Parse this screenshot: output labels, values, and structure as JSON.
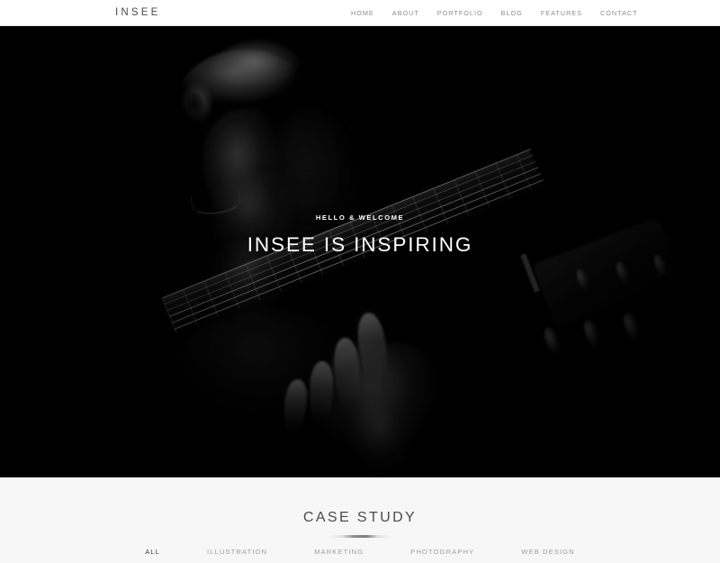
{
  "header": {
    "logo": "INSEE",
    "nav": [
      {
        "label": "HOME"
      },
      {
        "label": "ABOUT"
      },
      {
        "label": "PORTFOLIO"
      },
      {
        "label": "BLOG"
      },
      {
        "label": "FEATURES"
      },
      {
        "label": "CONTACT"
      }
    ]
  },
  "hero": {
    "subtitle": "HELLO & WELCOME",
    "title": "INSEE IS INSPIRING",
    "background_description": "dark monochrome photo of a man's face in profile with a hand fretting an acoustic guitar neck",
    "background_color": "#000000"
  },
  "case_study": {
    "title": "CASE STUDY",
    "filters": [
      {
        "label": "ALL",
        "active": true
      },
      {
        "label": "ILLUSTRATION",
        "active": false
      },
      {
        "label": "MARKETING",
        "active": false
      },
      {
        "label": "PHOTOGRAPHY",
        "active": false
      },
      {
        "label": "WEB DESIGN",
        "active": false
      }
    ],
    "background_color": "#f7f7f7"
  },
  "colors": {
    "page_background": "#ffffff",
    "header_text": "#8c8c8c",
    "logo_text": "#4a4a4a",
    "hero_text": "#ffffff",
    "heading_text": "#4b4b4b"
  }
}
